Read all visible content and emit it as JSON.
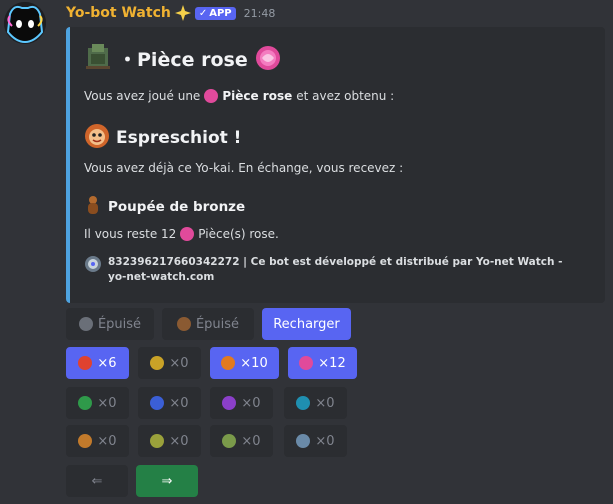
{
  "message": {
    "author": "Yo-bot Watch",
    "badge": "APP",
    "timestamp": "21:48"
  },
  "embed": {
    "title": "・Pièce rose",
    "line1_pre": "Vous avez joué une",
    "line1_item": "Pièce rose",
    "line1_post": "et avez obtenu :",
    "yokai_name": "Espreschiot !",
    "line2": "Vous avez déjà ce Yo-kai. En échange, vous recevez :",
    "reward_name": "Poupée de bronze",
    "remaining_pre": "Il vous reste 12",
    "remaining_post": "Pièce(s) rose.",
    "footer": "832396217660342272 | Ce bot est développé et distribué par Yo-net Watch - yo-net-watch.com",
    "accent_color": "#4ea3e0"
  },
  "buttons": {
    "row1": [
      {
        "label": "Épuisé",
        "icon": "coin-icon"
      },
      {
        "label": "Épuisé",
        "icon": "coin-icon"
      },
      {
        "label": "Recharger"
      }
    ],
    "coins": [
      {
        "count": "×6",
        "color": "#e0422f",
        "active": true
      },
      {
        "count": "×0",
        "color": "#c9a227",
        "active": false
      },
      {
        "count": "×10",
        "color": "#e27a1f",
        "active": true
      },
      {
        "count": "×12",
        "color": "#e04a9b",
        "active": true
      },
      {
        "count": "×0",
        "color": "#2f9a4a",
        "active": false
      },
      {
        "count": "×0",
        "color": "#3b5fd6",
        "active": false
      },
      {
        "count": "×0",
        "color": "#8b3fc9",
        "active": false
      },
      {
        "count": "×0",
        "color": "#1f8fb0",
        "active": false
      },
      {
        "count": "×0",
        "color": "#c27a2b",
        "active": false
      },
      {
        "count": "×0",
        "color": "#9aa13b",
        "active": false
      },
      {
        "count": "×0",
        "color": "#7a9a4a",
        "active": false
      },
      {
        "count": "×0",
        "color": "#6a8aa8",
        "active": false
      }
    ],
    "prev": "⇐",
    "next": "⇒"
  },
  "colors": {
    "primary": "#5865f2",
    "success": "#248046",
    "username": "#f0b232"
  }
}
